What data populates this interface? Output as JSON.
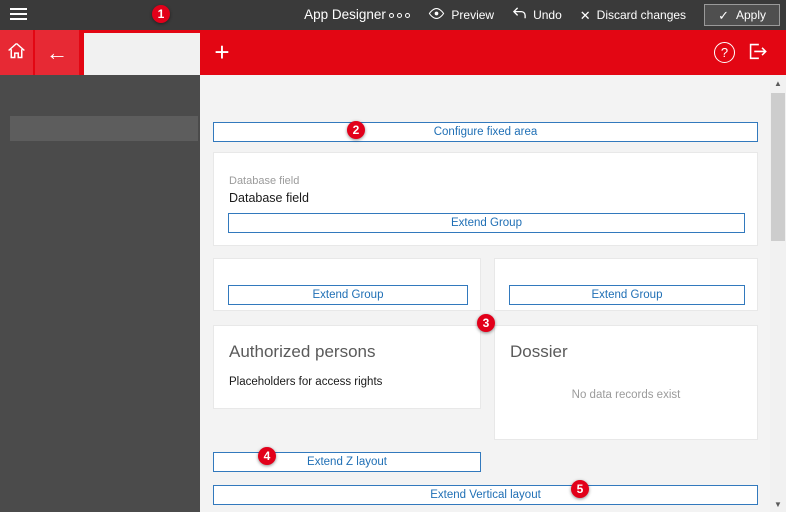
{
  "topbar": {
    "title": "App Designer",
    "preview": "Preview",
    "undo": "Undo",
    "discard": "Discard changes",
    "apply": "Apply"
  },
  "icons": {
    "back_arrow": "←",
    "add_plus": "+",
    "help_question": "?",
    "discard_x": "✕",
    "apply_check": "✓",
    "scroll_up": "▲",
    "scroll_down": "▼"
  },
  "content": {
    "configure_fixed_area": "Configure fixed area",
    "database_field_label": "Database field",
    "database_field_value": "Database field",
    "extend_group": "Extend Group",
    "authorized_persons_title": "Authorized persons",
    "authorized_persons_subtitle": "Placeholders for access rights",
    "dossier_title": "Dossier",
    "dossier_empty": "No data records exist",
    "extend_z_layout": "Extend Z layout",
    "extend_vertical_layout": "Extend Vertical layout"
  },
  "annotations": [
    "1",
    "2",
    "3",
    "4",
    "5"
  ],
  "colors": {
    "topbar_bg": "#3a3a3a",
    "accent_red": "#e30613",
    "badge_red": "#e2001a",
    "button_blue": "#1f6fb5",
    "sidebar_bg": "#4b4b4b"
  }
}
